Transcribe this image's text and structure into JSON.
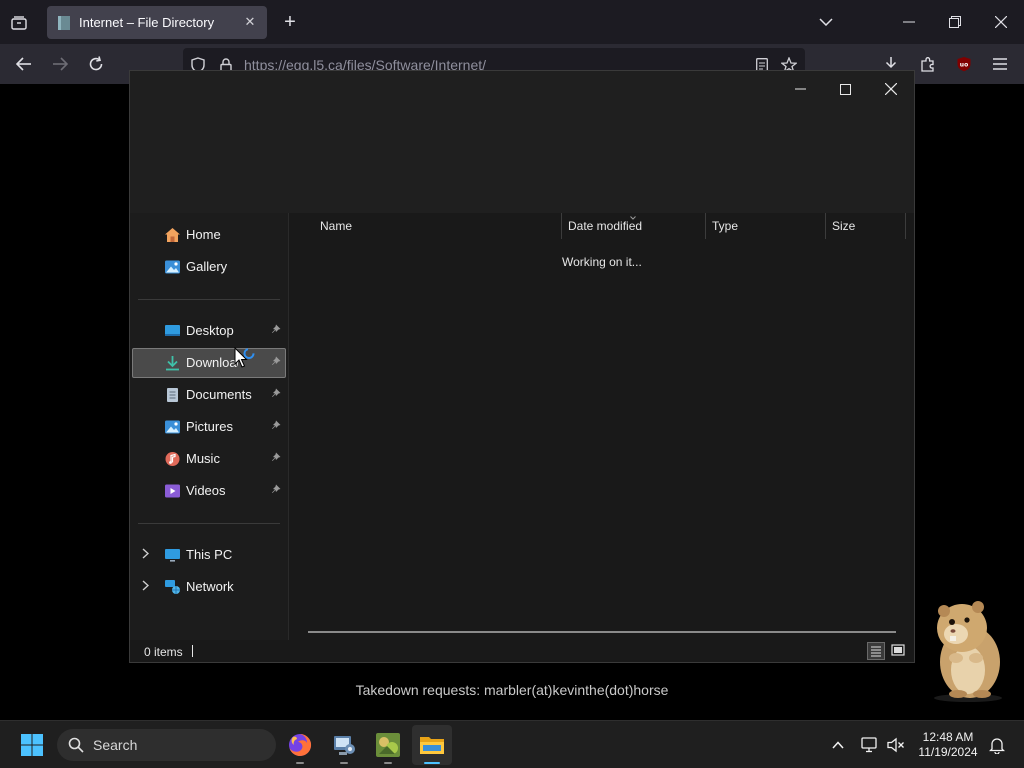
{
  "browser": {
    "tab_title": "Internet – File Directory",
    "url": "https://egg.l5.ca/files/Software/Internet/"
  },
  "explorer": {
    "sidebar": {
      "quick": [
        {
          "label": "Home"
        },
        {
          "label": "Gallery"
        }
      ],
      "pinned": [
        {
          "label": "Desktop"
        },
        {
          "label": "Downloads"
        },
        {
          "label": "Documents"
        },
        {
          "label": "Pictures"
        },
        {
          "label": "Music"
        },
        {
          "label": "Videos"
        }
      ],
      "locations": [
        {
          "label": "This PC"
        },
        {
          "label": "Network"
        }
      ]
    },
    "columns": [
      "Name",
      "Date modified",
      "Type",
      "Size"
    ],
    "working_text": "Working on it...",
    "status_count": "0 items"
  },
  "footer_text": "Takedown requests: marbler(at)kevinthe(dot)horse",
  "taskbar": {
    "search_label": "Search",
    "time": "12:48 AM",
    "date": "11/19/2024"
  },
  "colors": {
    "accent": "#4cc2ff",
    "selected_bg": "#4a4a4a",
    "browser_tabbar": "#1c1b22",
    "browser_navbar": "#2b2a33"
  }
}
